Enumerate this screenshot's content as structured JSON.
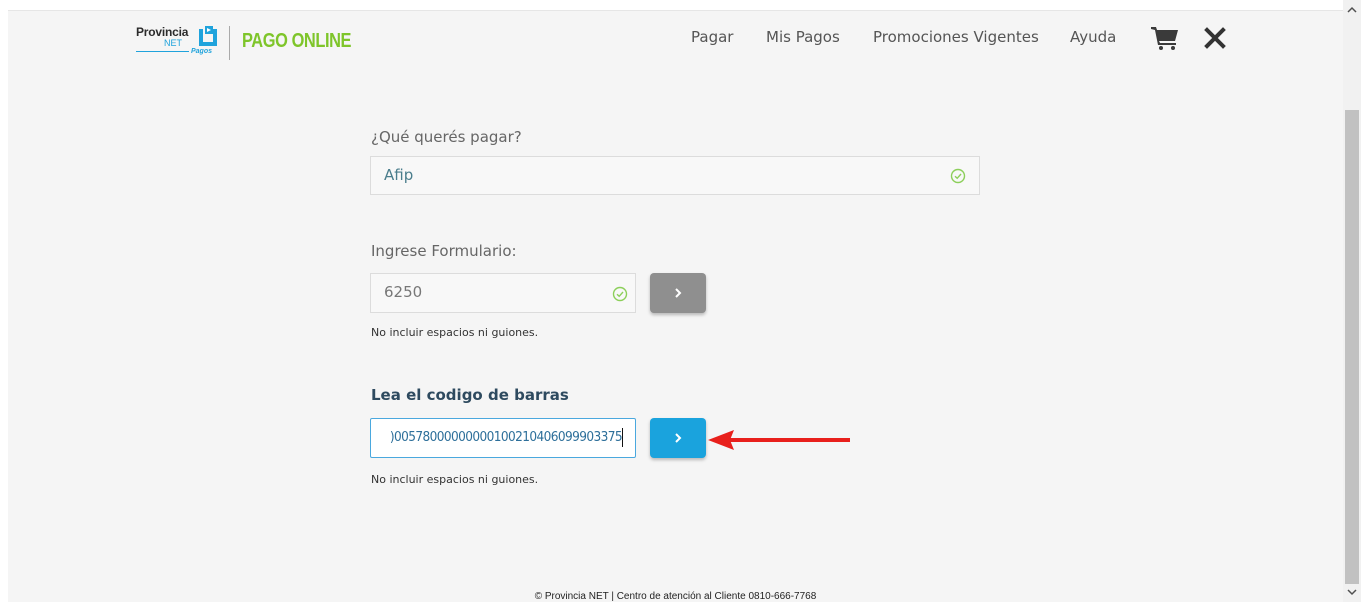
{
  "header": {
    "logo_provincia": "Provincia",
    "logo_net": "NET",
    "logo_pagos": "Pagos",
    "brand": "PAGO ONLINE",
    "nav": [
      "Pagar",
      "Mis Pagos",
      "Promociones Vigentes",
      "Ayuda"
    ],
    "icons": [
      "cart-icon",
      "close-icon"
    ]
  },
  "form": {
    "what_label": "¿Qué querés pagar?",
    "what_value": "Afip",
    "formulario_label": "Ingrese Formulario:",
    "formulario_value": "6250",
    "formulario_hint": "No incluir espacios ni guiones.",
    "barcode_heading": "Lea el codigo de barras",
    "barcode_value": ")00578000000000100210406099903375",
    "barcode_hint": "No incluir espacios ni guiones."
  },
  "footer": {
    "text": "© Provincia NET | Centro de atención al Cliente 0810-666-7768"
  },
  "colors": {
    "brand_green": "#7ec52a",
    "accent_blue": "#1aa3dd",
    "button_gray": "#8f8f8f",
    "check_green": "#8ccf5a",
    "arrow_red": "#e8201c"
  }
}
